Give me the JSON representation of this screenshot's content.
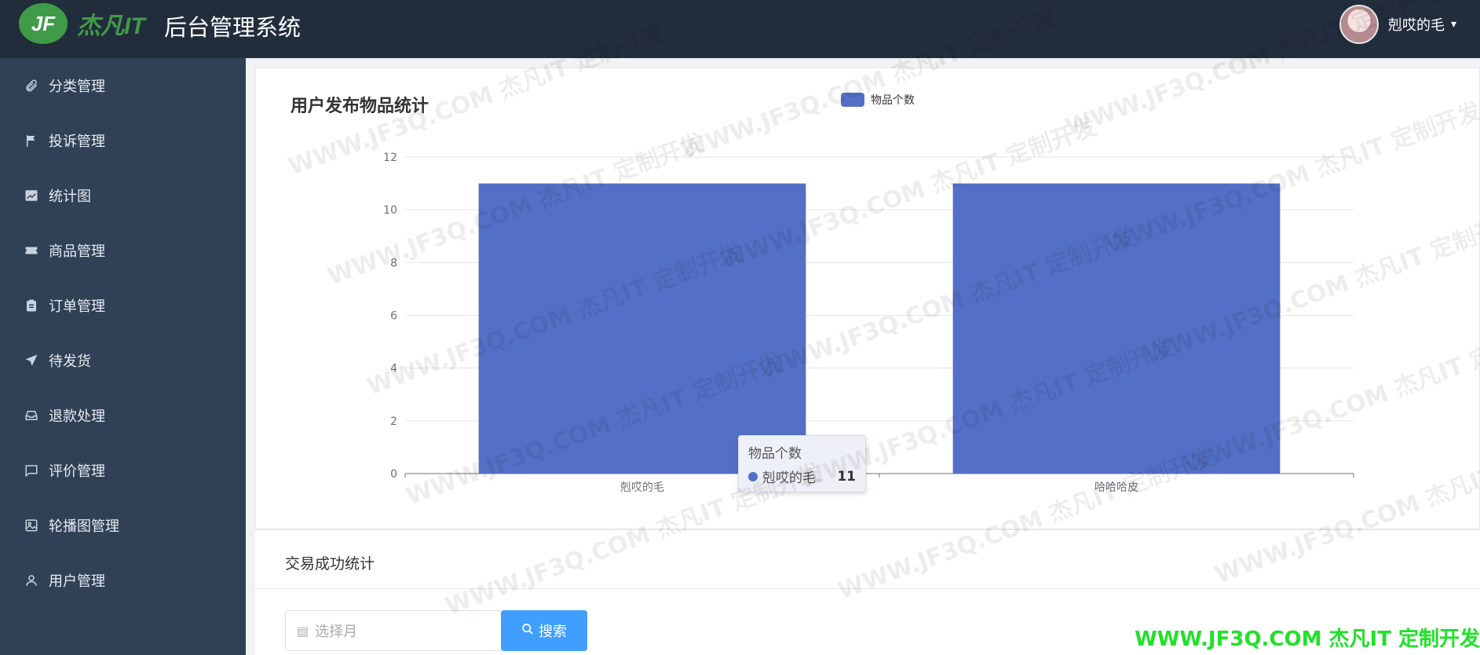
{
  "header": {
    "logo_badge": "JF",
    "logo_text": "杰凡IT",
    "title": "后台管理系统",
    "user_name": "剋哎的毛",
    "caret": "▾"
  },
  "sidebar": {
    "items": [
      {
        "label": "分类管理",
        "icon": "paperclip-icon"
      },
      {
        "label": "投诉管理",
        "icon": "flag-icon"
      },
      {
        "label": "统计图",
        "icon": "chart-icon"
      },
      {
        "label": "商品管理",
        "icon": "ticket-icon"
      },
      {
        "label": "订单管理",
        "icon": "clipboard-icon"
      },
      {
        "label": "待发货",
        "icon": "send-icon"
      },
      {
        "label": "退款处理",
        "icon": "inbox-icon"
      },
      {
        "label": "评价管理",
        "icon": "comment-icon"
      },
      {
        "label": "轮播图管理",
        "icon": "image-icon"
      },
      {
        "label": "用户管理",
        "icon": "user-icon"
      }
    ]
  },
  "chart_card": {
    "title": "用户发布物品统计"
  },
  "chart_data": {
    "type": "bar",
    "categories": [
      "剋哎的毛",
      "哈哈哈皮"
    ],
    "series": [
      {
        "name": "物品个数",
        "values": [
          11,
          11
        ],
        "color": "#5470c6"
      }
    ],
    "ylim": [
      0,
      12
    ],
    "yticks": [
      0,
      2,
      4,
      6,
      8,
      10,
      12
    ],
    "grid": true,
    "legend": "top-center"
  },
  "tooltip": {
    "title": "物品个数",
    "category": "剋哎的毛",
    "value": "11"
  },
  "trade_section": {
    "title": "交易成功统计",
    "date_placeholder": "选择月",
    "search_label": "搜索"
  },
  "watermark": {
    "text": "WWW.JF3Q.COM 杰凡IT 定制开发",
    "footer": "WWW.JF3Q.COM 杰凡IT  定制开发"
  }
}
